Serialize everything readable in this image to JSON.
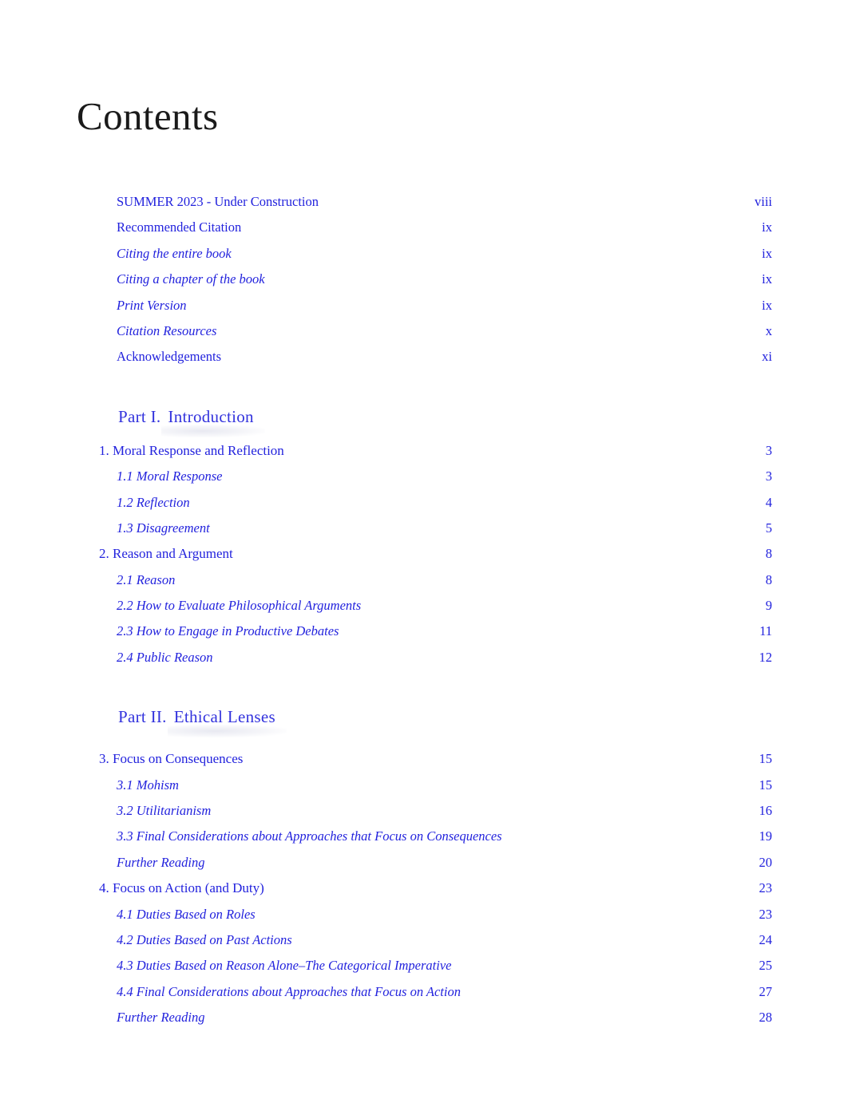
{
  "document": {
    "page_title": "Contents",
    "text_color": "#2222dd",
    "title_color": "#1a1a1a",
    "background": "#ffffff"
  },
  "front_matter": [
    {
      "label": "SUMMER 2023 - Under Construction",
      "page": "viii",
      "style": "upright"
    },
    {
      "label": "Recommended Citation",
      "page": "ix",
      "style": "upright"
    },
    {
      "label": "Citing the entire book",
      "page": "ix",
      "style": "italic"
    },
    {
      "label": "Citing a chapter of the book",
      "page": "ix",
      "style": "italic"
    },
    {
      "label": "Print Version",
      "page": "ix",
      "style": "italic"
    },
    {
      "label": "Citation Resources",
      "page": "x",
      "style": "italic"
    },
    {
      "label": "Acknowledgements",
      "page": "xi",
      "style": "upright"
    }
  ],
  "parts": [
    {
      "part_label": "Part I.",
      "part_name": "Introduction",
      "entries": [
        {
          "label": "1. Moral Response and Reflection",
          "page": "3",
          "level": "chap",
          "style": "upright"
        },
        {
          "label": "1.1 Moral Response",
          "page": "3",
          "level": "sec",
          "style": "italic"
        },
        {
          "label": "1.2 Reflection",
          "page": "4",
          "level": "sec",
          "style": "italic"
        },
        {
          "label": "1.3 Disagreement",
          "page": "5",
          "level": "sec",
          "style": "italic"
        },
        {
          "label": "2. Reason and Argument",
          "page": "8",
          "level": "chap",
          "style": "upright"
        },
        {
          "label": "2.1 Reason",
          "page": "8",
          "level": "sec",
          "style": "italic"
        },
        {
          "label": "2.2 How to Evaluate Philosophical Arguments",
          "page": "9",
          "level": "sec",
          "style": "italic"
        },
        {
          "label": "2.3 How to Engage in Productive Debates",
          "page": "11",
          "level": "sec",
          "style": "italic"
        },
        {
          "label": "2.4 Public Reason",
          "page": "12",
          "level": "sec",
          "style": "italic"
        }
      ]
    },
    {
      "part_label": "Part II.",
      "part_name": "Ethical Lenses",
      "entries": [
        {
          "label": "3. Focus on Consequences",
          "page": "15",
          "level": "chap",
          "style": "upright"
        },
        {
          "label": "3.1 Mohism",
          "page": "15",
          "level": "sec",
          "style": "italic"
        },
        {
          "label": "3.2 Utilitarianism",
          "page": "16",
          "level": "sec",
          "style": "italic"
        },
        {
          "label": "3.3 Final Considerations about Approaches that Focus on Consequences",
          "page": "19",
          "level": "sec",
          "style": "italic"
        },
        {
          "label": "Further Reading",
          "page": "20",
          "level": "sec",
          "style": "italic"
        },
        {
          "label": "4. Focus on Action (and Duty)",
          "page": "23",
          "level": "chap",
          "style": "upright"
        },
        {
          "label": "4.1 Duties Based on Roles",
          "page": "23",
          "level": "sec",
          "style": "italic"
        },
        {
          "label": "4.2 Duties Based on Past Actions",
          "page": "24",
          "level": "sec",
          "style": "italic"
        },
        {
          "label": "4.3 Duties Based on Reason Alone–The Categorical Imperative",
          "page": "25",
          "level": "sec",
          "style": "italic"
        },
        {
          "label": "4.4 Final Considerations about Approaches that Focus on Action",
          "page": "27",
          "level": "sec",
          "style": "italic"
        },
        {
          "label": "Further Reading",
          "page": "28",
          "level": "sec",
          "style": "italic"
        }
      ]
    }
  ]
}
